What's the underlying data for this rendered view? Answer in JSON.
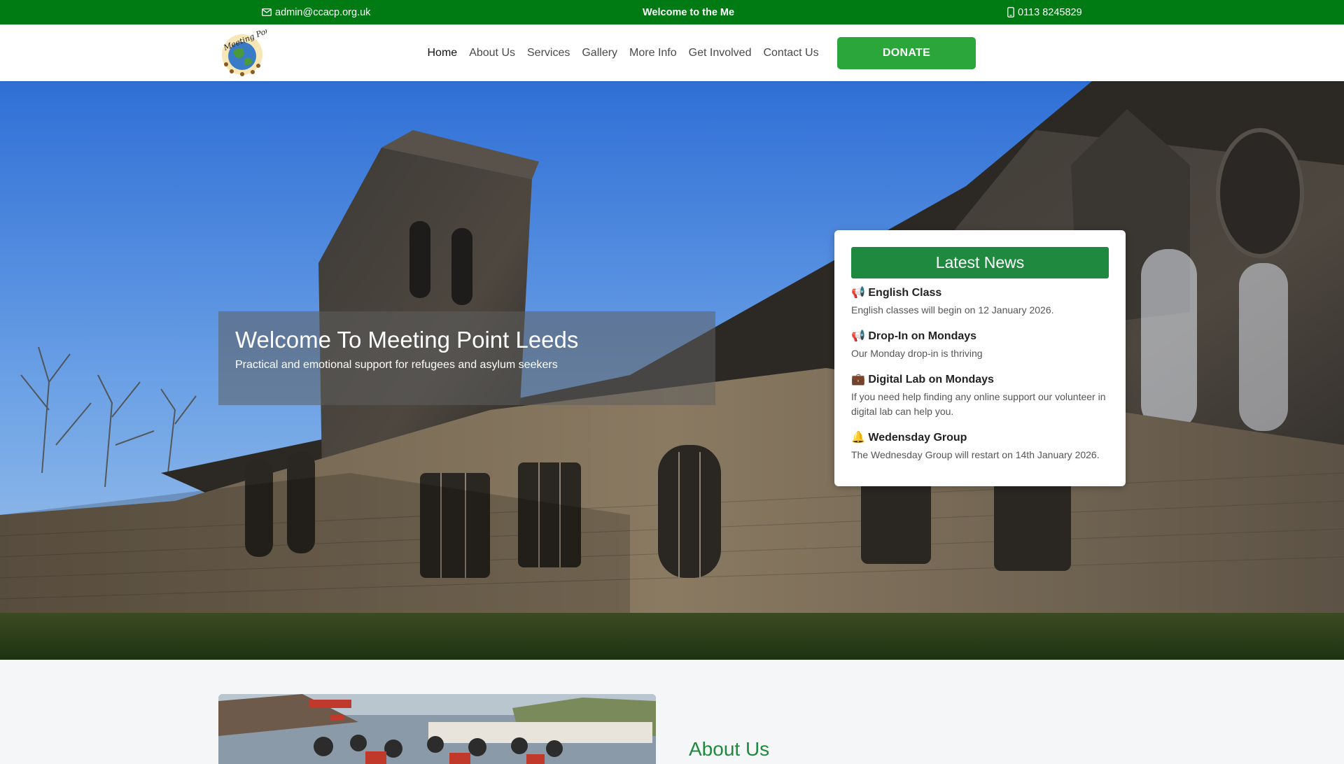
{
  "topbar": {
    "email": "admin@ccacp.org.uk",
    "welcome": "Welcome to the Me",
    "phone": "0113 8245829"
  },
  "nav": {
    "items": [
      {
        "label": "Home",
        "active": true
      },
      {
        "label": "About Us"
      },
      {
        "label": "Services"
      },
      {
        "label": "Gallery"
      },
      {
        "label": "More Info"
      },
      {
        "label": "Get Involved"
      },
      {
        "label": "Contact Us"
      }
    ],
    "donate_label": "DONATE"
  },
  "hero": {
    "title": "Welcome To Meeting Point Leeds",
    "subtitle": "Practical and emotional support for refugees and asylum seekers"
  },
  "news": {
    "header": "Latest News",
    "items": [
      {
        "icon": "📢",
        "title": "English Class",
        "text": "English classes will begin on 12 January 2026."
      },
      {
        "icon": "📢",
        "title": "Drop-In on Mondays",
        "text": "Our Monday drop-in is thriving"
      },
      {
        "icon": "💼",
        "title": "Digital Lab on Mondays",
        "text": "If you need help finding any online support our volunteer in digital lab can help you."
      },
      {
        "icon": "🔔",
        "title": "Wedensday Group",
        "text": "The Wednesday Group will restart on 14th January 2026."
      }
    ]
  },
  "about": {
    "title": "About Us"
  },
  "colors": {
    "topbar": "#007a12",
    "donate": "#2aa63a",
    "news_header": "#1f8a3f"
  }
}
